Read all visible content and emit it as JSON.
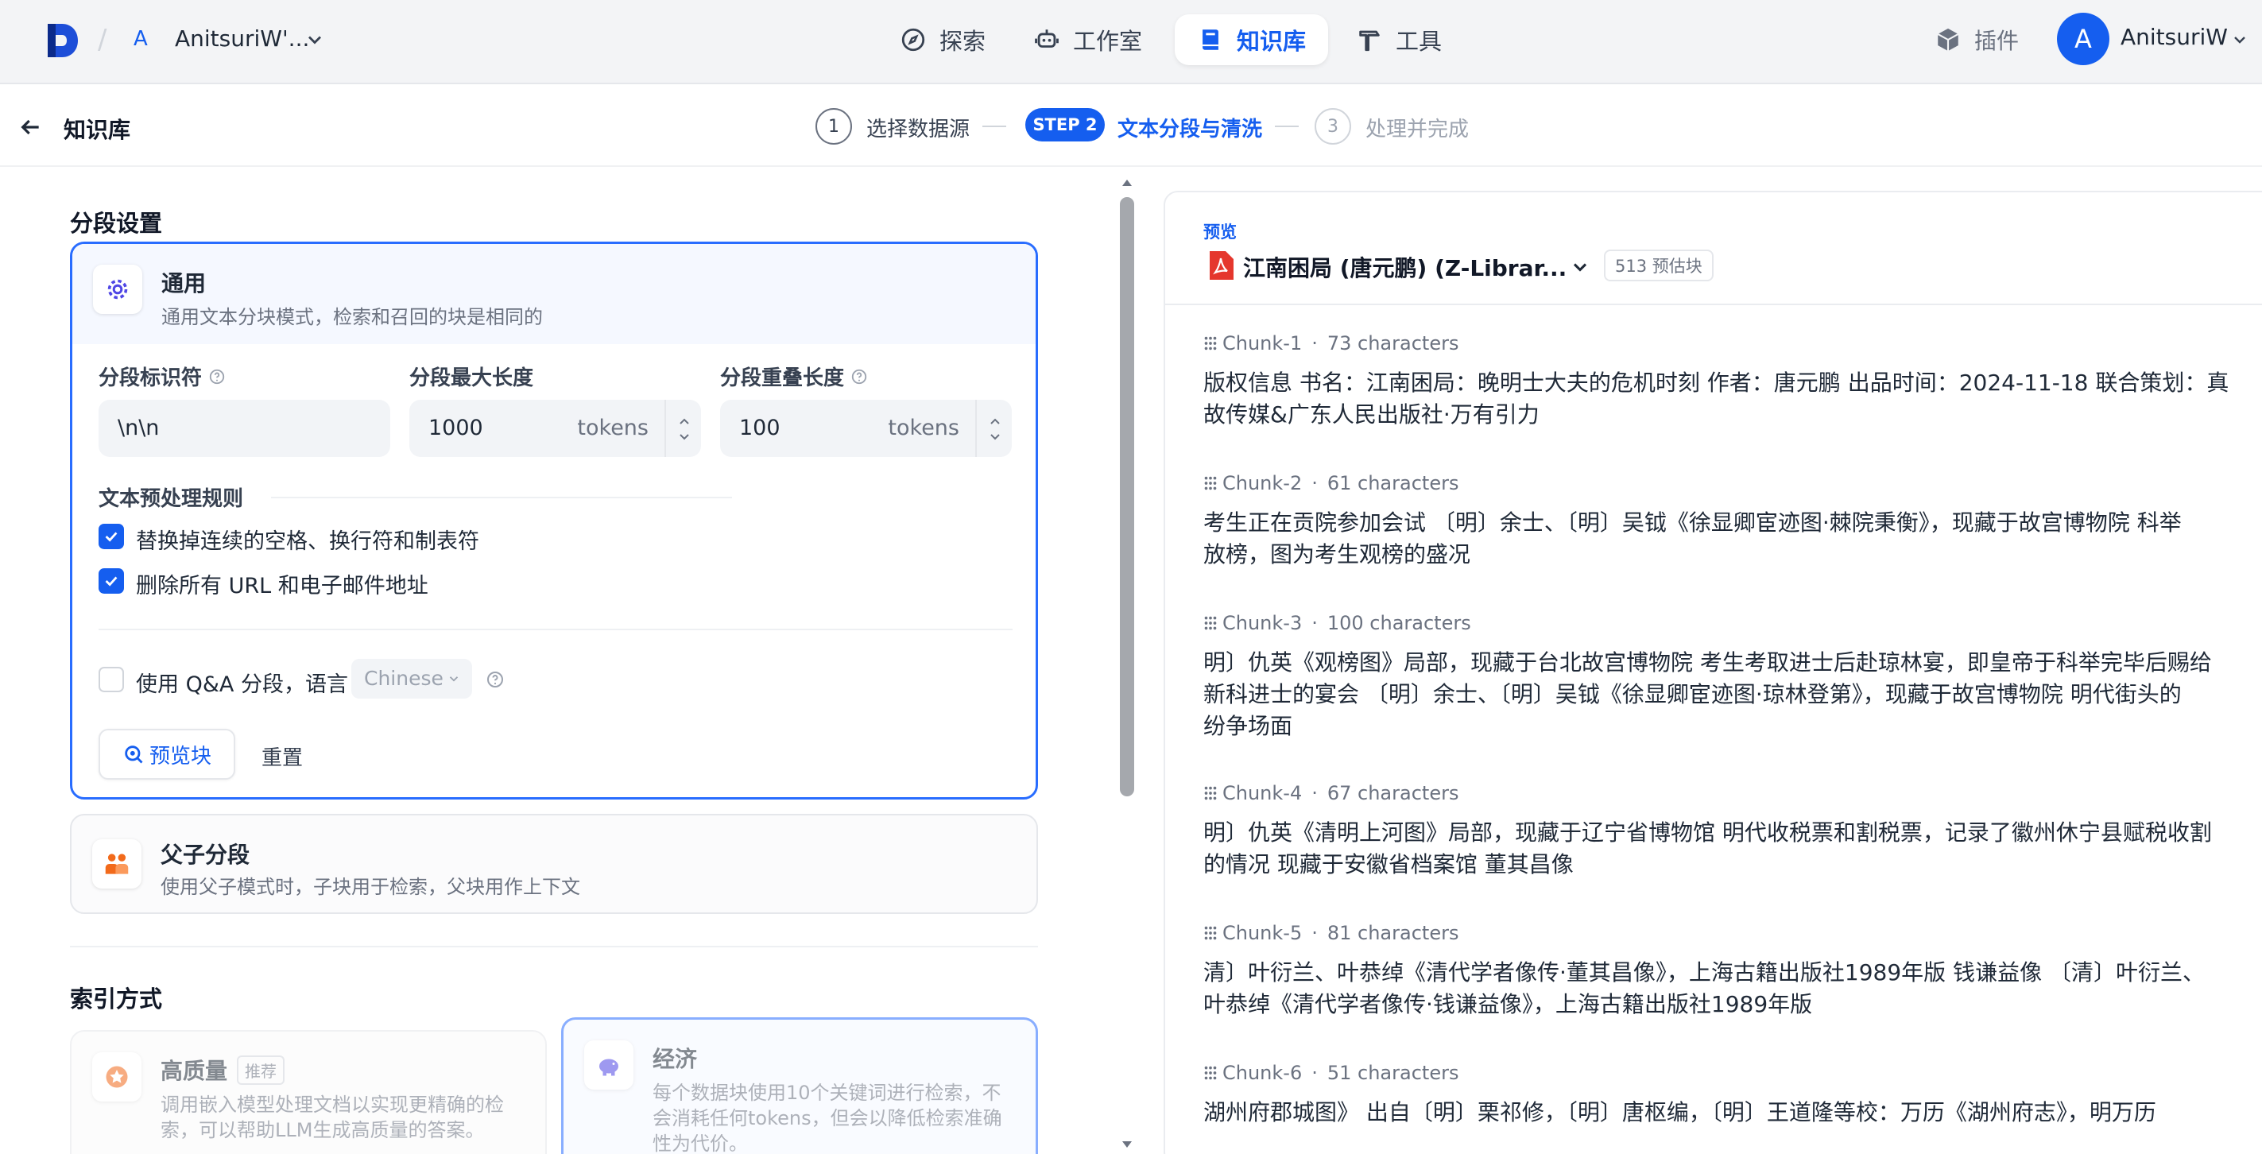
{
  "header": {
    "workspace_badge": "A",
    "workspace_name": "AnitsuriW'...",
    "nav": [
      {
        "label": "探索",
        "icon": "compass-icon"
      },
      {
        "label": "工作室",
        "icon": "robot-icon"
      },
      {
        "label": "知识库",
        "icon": "book-icon",
        "active": true
      },
      {
        "label": "工具",
        "icon": "hammer-icon"
      }
    ],
    "plugin_label": "插件",
    "user_initial": "A",
    "user_name": "AnitsuriW"
  },
  "subbar": {
    "title": "知识库",
    "steps": [
      {
        "num": "1",
        "label": "选择数据源"
      },
      {
        "num": "STEP 2",
        "label": "文本分段与清洗",
        "active": true
      },
      {
        "num": "3",
        "label": "处理并完成"
      }
    ]
  },
  "segment": {
    "section_title": "分段设置",
    "general": {
      "title": "通用",
      "desc": "通用文本分块模式，检索和召回的块是相同的",
      "delimiter_label": "分段标识符",
      "delimiter_value": "\\n\\n",
      "max_len_label": "分段最大长度",
      "max_len_value": "1000",
      "max_len_unit": "tokens",
      "overlap_label": "分段重叠长度",
      "overlap_value": "100",
      "overlap_unit": "tokens",
      "rules_title": "文本预处理规则",
      "rule1": "替换掉连续的空格、换行符和制表符",
      "rule1_checked": true,
      "rule2": "删除所有 URL 和电子邮件地址",
      "rule2_checked": true,
      "qa_label": "使用 Q&A 分段，语言",
      "qa_checked": false,
      "qa_lang": "Chinese",
      "preview_btn": "预览块",
      "reset_btn": "重置"
    },
    "parent_child": {
      "title": "父子分段",
      "desc": "使用父子模式时，子块用于检索，父块用作上下文"
    }
  },
  "index": {
    "section_title": "索引方式",
    "high_quality": {
      "title": "高质量",
      "badge": "推荐",
      "desc1": "调用嵌入模型处理文档以实现更精确的检",
      "desc2": "索，可以帮助LLM生成高质量的答案。"
    },
    "economy": {
      "title": "经济",
      "desc1": "每个数据块使用10个关键词进行检索，不",
      "desc2": "会消耗任何tokens，但会以降低检索准确",
      "desc3": "性为代价。"
    }
  },
  "preview": {
    "tag": "预览",
    "doc_title": "江南困局 (唐元鹏) (Z-Librar...",
    "count": "513 预估块",
    "chunks": [
      {
        "name": "Chunk-1",
        "chars": "73 characters",
        "lines": [
          "版权信息 书名：江南困局：晚明士大夫的危机时刻 作者：唐元鹏 出品时间：2024-11-18 联合策划：真",
          "故传媒&广东人民出版社·万有引力"
        ]
      },
      {
        "name": "Chunk-2",
        "chars": "61 characters",
        "lines": [
          "考生正在贡院参加会试 〔明〕余士、〔明〕吴钺《徐显卿宦迹图·棘院秉衡》，现藏于故宫博物院 科举",
          "放榜，图为考生观榜的盛况"
        ]
      },
      {
        "name": "Chunk-3",
        "chars": "100 characters",
        "lines": [
          "明〕仇英《观榜图》局部，现藏于台北故宫博物院 考生考取进士后赴琼林宴，即皇帝于科举完毕后赐给",
          "新科进士的宴会 〔明〕余士、〔明〕吴钺《徐显卿宦迹图·琼林登第》，现藏于故宫博物院 明代街头的",
          "纷争场面"
        ]
      },
      {
        "name": "Chunk-4",
        "chars": "67 characters",
        "lines": [
          "明〕仇英《清明上河图》局部，现藏于辽宁省博物馆 明代收税票和割税票，记录了徽州休宁县赋税收割",
          "的情况 现藏于安徽省档案馆 董其昌像"
        ]
      },
      {
        "name": "Chunk-5",
        "chars": "81 characters",
        "lines": [
          "清〕叶衍兰、叶恭绰《清代学者像传·董其昌像》，上海古籍出版社1989年版 钱谦益像 〔清〕叶衍兰、",
          "叶恭绰《清代学者像传·钱谦益像》，上海古籍出版社1989年版"
        ]
      },
      {
        "name": "Chunk-6",
        "chars": "51 characters",
        "lines": [
          "湖州府郡城图》 出自〔明〕栗祁修，〔明〕唐枢编，〔明〕王道隆等校：万历《湖州府志》，明万历"
        ]
      }
    ]
  },
  "colors": {
    "accent": "#155eef",
    "border_active": "#296dff",
    "pdf_red": "#e5372d",
    "orange": "#f26a1b"
  }
}
